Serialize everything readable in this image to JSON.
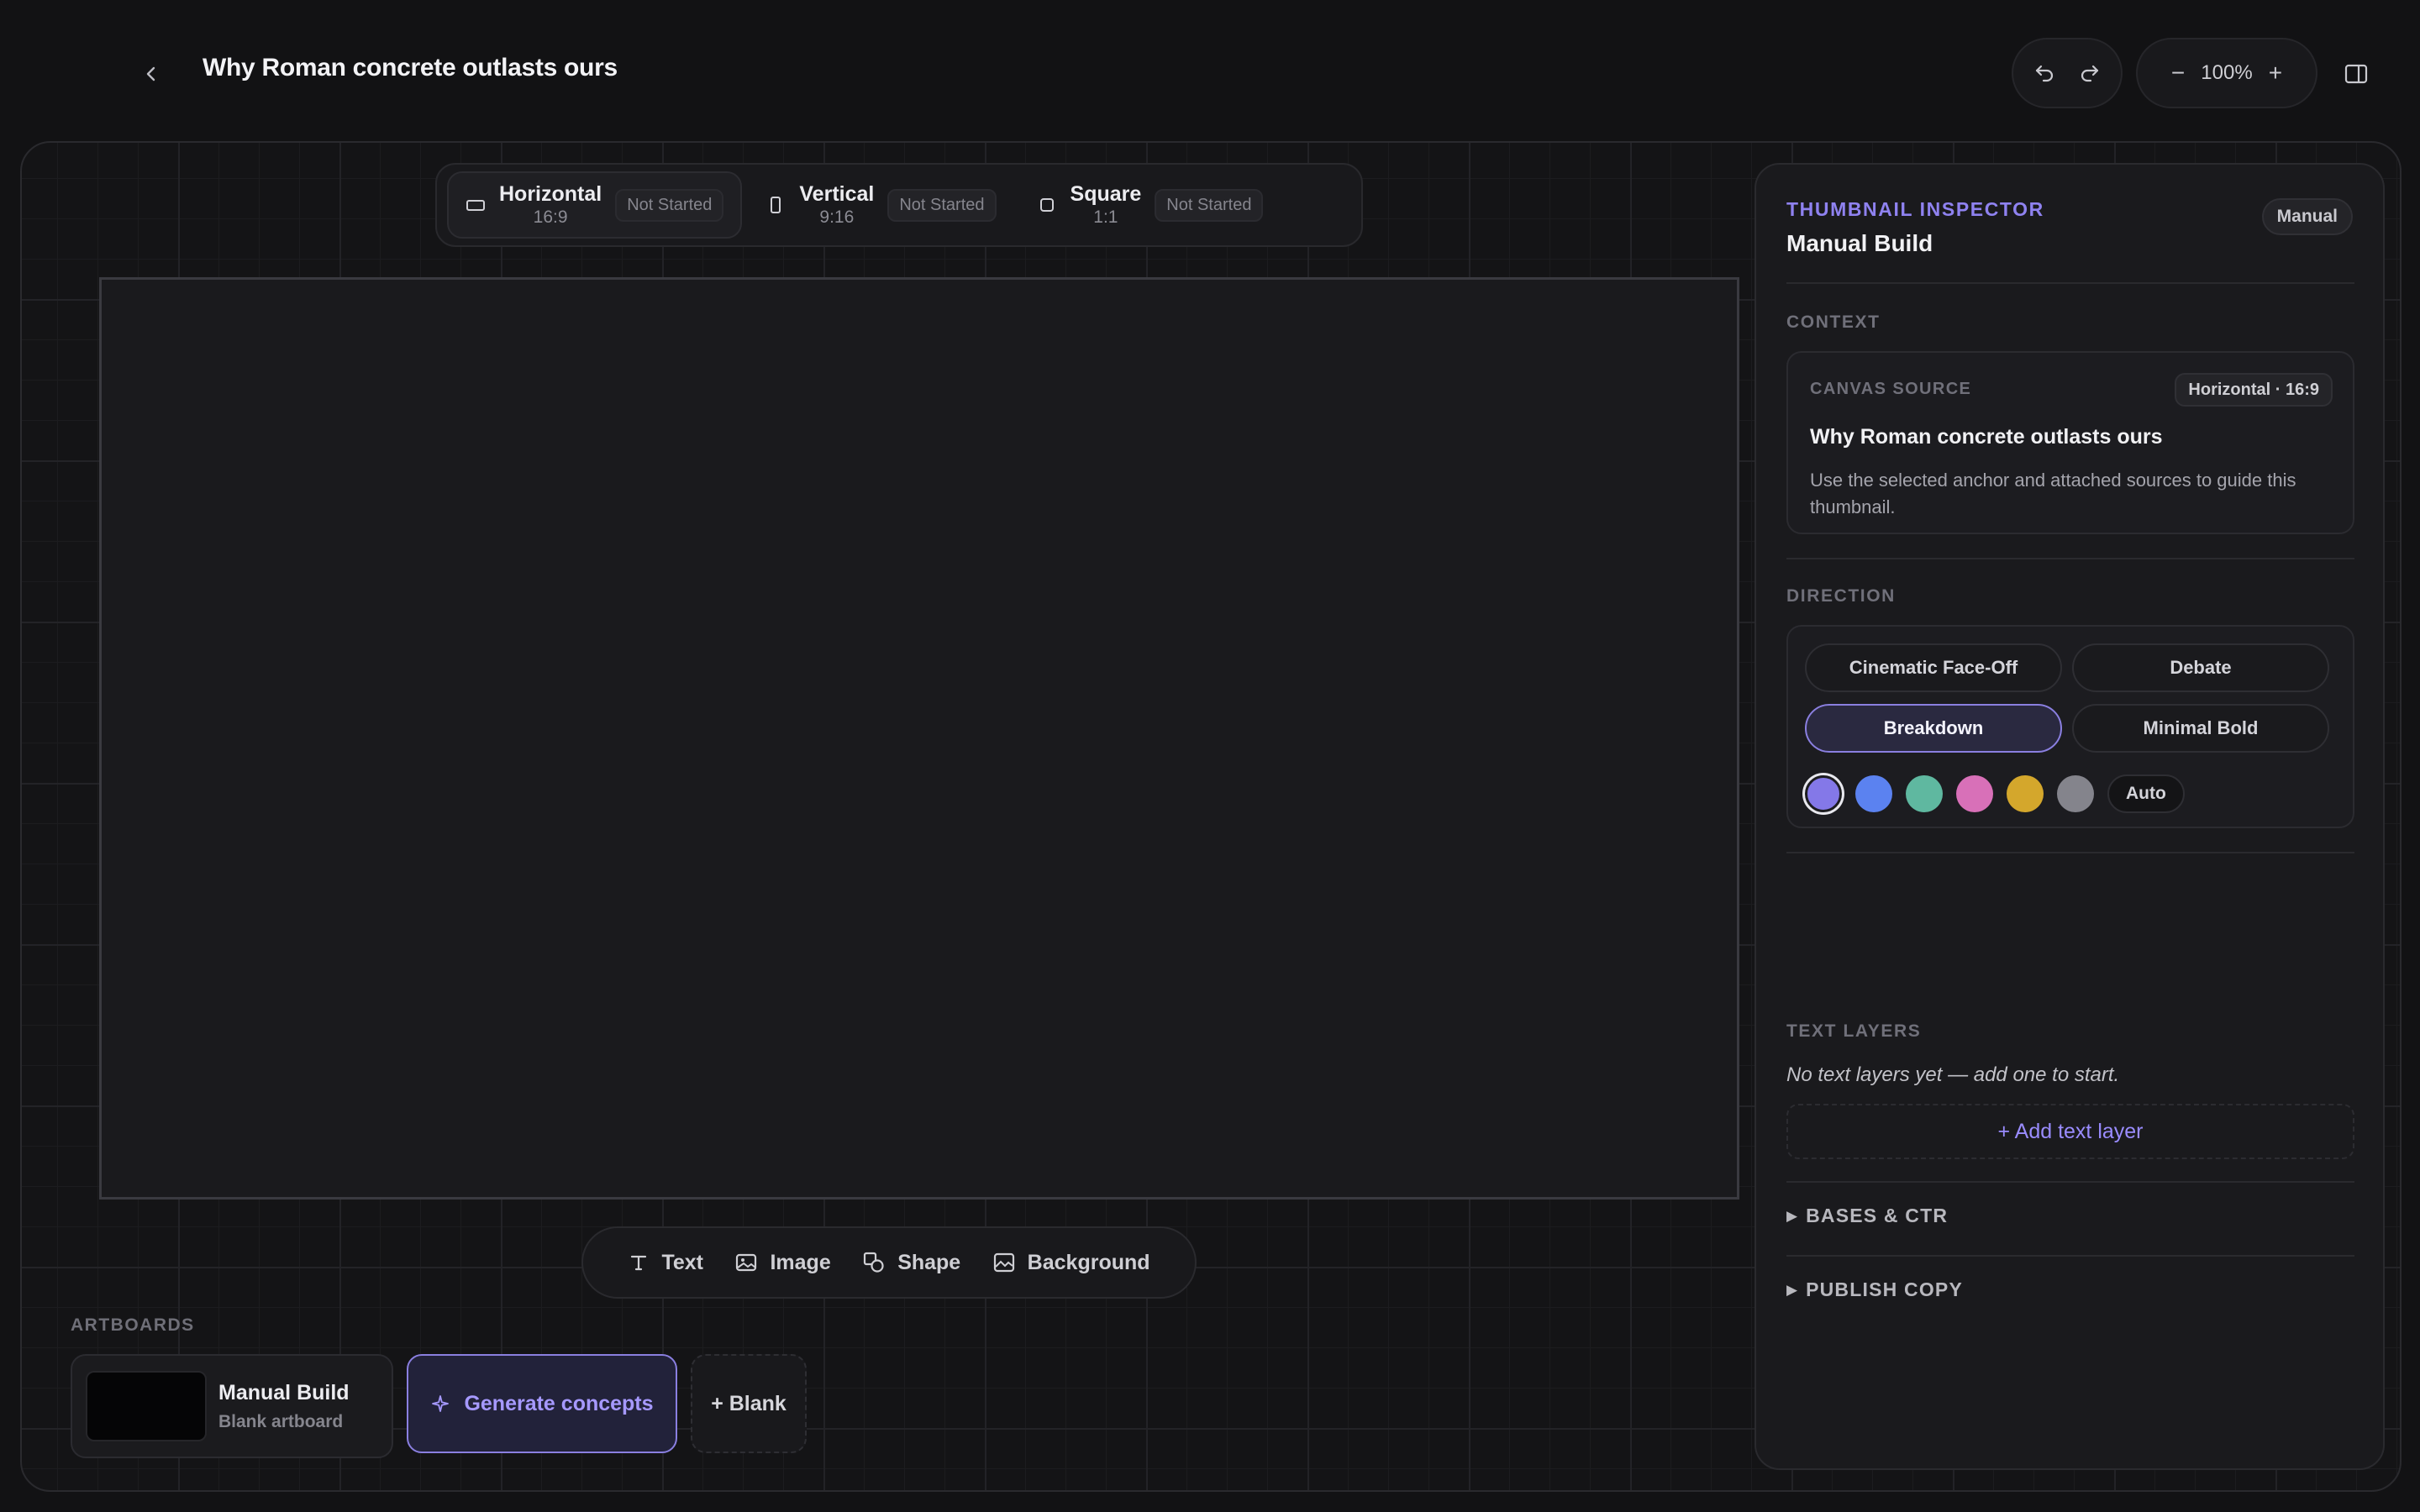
{
  "header": {
    "title": "Why Roman concrete outlasts ours",
    "zoom": "100%",
    "zoom_out": "−",
    "zoom_in": "+"
  },
  "formats": [
    {
      "name": "Horizontal",
      "ratio": "16:9",
      "status": "Not Started",
      "active": true
    },
    {
      "name": "Vertical",
      "ratio": "9:16",
      "status": "Not Started",
      "active": false
    },
    {
      "name": "Square",
      "ratio": "1:1",
      "status": "Not Started",
      "active": false
    }
  ],
  "insert_toolbar": {
    "text": "Text",
    "image": "Image",
    "shape": "Shape",
    "background": "Background"
  },
  "artboards": {
    "label": "ARTBOARDS",
    "items": [
      {
        "name": "Manual Build",
        "subtitle": "Blank artboard"
      }
    ],
    "generate_label": "Generate concepts",
    "blank_label": "+ Blank"
  },
  "inspector": {
    "kicker": "THUMBNAIL INSPECTOR",
    "title": "Manual Build",
    "badge": "Manual",
    "context": {
      "label": "CONTEXT",
      "source_label": "CANVAS SOURCE",
      "source_badge": "Horizontal · 16:9",
      "source_title": "Why Roman concrete outlasts ours",
      "source_desc": "Use the selected anchor and attached sources to guide this thumbnail."
    },
    "direction": {
      "label": "DIRECTION",
      "options": [
        "Cinematic Face-Off",
        "Debate",
        "Breakdown",
        "Minimal Bold"
      ],
      "selected": "Breakdown",
      "swatches": [
        "#8478e8",
        "#5b82f0",
        "#5fb8a0",
        "#d870b8",
        "#d4a72c",
        "#84848c"
      ],
      "selected_swatch": "#8478e8",
      "auto_label": "Auto"
    },
    "text_layers": {
      "label": "TEXT LAYERS",
      "empty": "No text layers yet — add one to start.",
      "add_label": "+ Add text layer"
    },
    "bases_label": "BASES & CTR",
    "publish_label": "PUBLISH COPY"
  },
  "colors": {
    "accent": "#8f82f0",
    "background": "#121214",
    "panel": "#1a1a1d"
  }
}
